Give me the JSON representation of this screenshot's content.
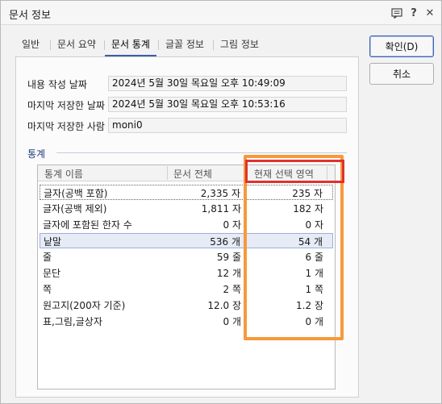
{
  "window": {
    "title": "문서 정보",
    "icons": [
      "chat-icon",
      "help-icon",
      "close-icon"
    ],
    "help_glyph": "?",
    "close_glyph": "✕"
  },
  "tabs": [
    {
      "label": "일반",
      "active": false
    },
    {
      "label": "문서 요약",
      "active": false
    },
    {
      "label": "문서 통계",
      "active": true
    },
    {
      "label": "글꼴 정보",
      "active": false
    },
    {
      "label": "그림 정보",
      "active": false
    }
  ],
  "fields": {
    "created_label": "내용 작성 날짜",
    "created_value": "2024년 5월 30일 목요일 오후 10:49:09",
    "saved_label": "마지막 저장한 날짜",
    "saved_value": "2024년 5월 30일 목요일 오후 10:53:16",
    "saver_label": "마지막 저장한 사람",
    "saver_value": "moni0"
  },
  "stats": {
    "group_label": "통계",
    "columns": [
      "통계 이름",
      "문서 전체",
      "현재 선택 영역"
    ],
    "rows": [
      {
        "name": "글자(공백 포함)",
        "total": "2,335 자",
        "selection": "235 자"
      },
      {
        "name": "글자(공백 제외)",
        "total": "1,811 자",
        "selection": "182 자"
      },
      {
        "name": "글자에 포함된 한자 수",
        "total": "0 자",
        "selection": "0 자"
      },
      {
        "name": "낱말",
        "total": "536 개",
        "selection": "54 개"
      },
      {
        "name": "줄",
        "total": "59 줄",
        "selection": "6 줄"
      },
      {
        "name": "문단",
        "total": "12 개",
        "selection": "1 개"
      },
      {
        "name": "쪽",
        "total": "2 쪽",
        "selection": "1 쪽"
      },
      {
        "name": "원고지(200자 기준)",
        "total": "12.0 장",
        "selection": "1.2 장"
      },
      {
        "name": "표,그림,글상자",
        "total": "0 개",
        "selection": "0 개"
      }
    ]
  },
  "buttons": {
    "ok": "확인(D)",
    "cancel": "취소"
  },
  "colors": {
    "annotation_orange": "#f59a3c",
    "annotation_red": "#e0312e",
    "accent": "#3a5fa8"
  }
}
